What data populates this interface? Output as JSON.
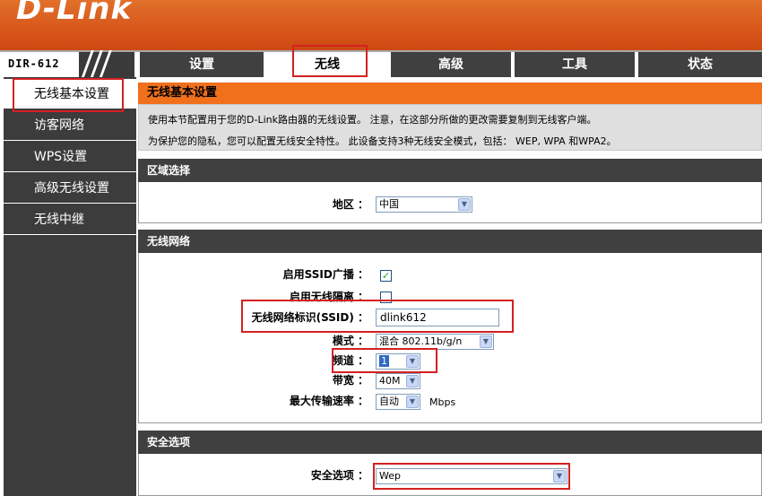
{
  "header": {
    "logo_text": "D-Link"
  },
  "model": {
    "label": "DIR-612"
  },
  "nav": {
    "tabs": [
      {
        "label": "设置"
      },
      {
        "label": "无线"
      },
      {
        "label": "高级"
      },
      {
        "label": "工具"
      },
      {
        "label": "状态"
      }
    ]
  },
  "sidebar": {
    "items": [
      {
        "label": "无线基本设置"
      },
      {
        "label": "访客网络"
      },
      {
        "label": "WPS设置"
      },
      {
        "label": "高级无线设置"
      },
      {
        "label": "无线中继"
      }
    ]
  },
  "main": {
    "title": "无线基本设置",
    "intro_line1": "使用本节配置用于您的D-Link路由器的无线设置。 注意，在这部分所做的更改需要复制到无线客户端。",
    "intro_line2": "为保护您的隐私，您可以配置无线安全特性。 此设备支持3种无线安全模式，包括： WEP, WPA 和WPA2。"
  },
  "region": {
    "heading": "区域选择",
    "label": "地区 ：",
    "value": "中国"
  },
  "wireless": {
    "heading": "无线网络",
    "ssid_broadcast_label": "启用SSID广播 ：",
    "ssid_broadcast_checked": true,
    "isolation_label": "启用无线隔离 ：",
    "isolation_checked": false,
    "ssid_label": "无线网络标识(SSID) ：",
    "ssid_value": "dlink612",
    "mode_label": "模式 ：",
    "mode_value": "混合 802.11b/g/n",
    "channel_label": "频道 ：",
    "channel_value": "1",
    "bandwidth_label": "带宽 ：",
    "bandwidth_value": "40M",
    "rate_label": "最大传输速率 ：",
    "rate_value": "自动",
    "rate_unit": "Mbps"
  },
  "security": {
    "heading": "安全选项",
    "label": "安全选项 ：",
    "value": "Wep"
  },
  "icons": {
    "dropdown": "chevron-down-icon",
    "check": "checkmark-icon"
  },
  "colors": {
    "brand_orange": "#f0701c",
    "nav_dark": "#404040",
    "highlight_red": "#d42020"
  }
}
